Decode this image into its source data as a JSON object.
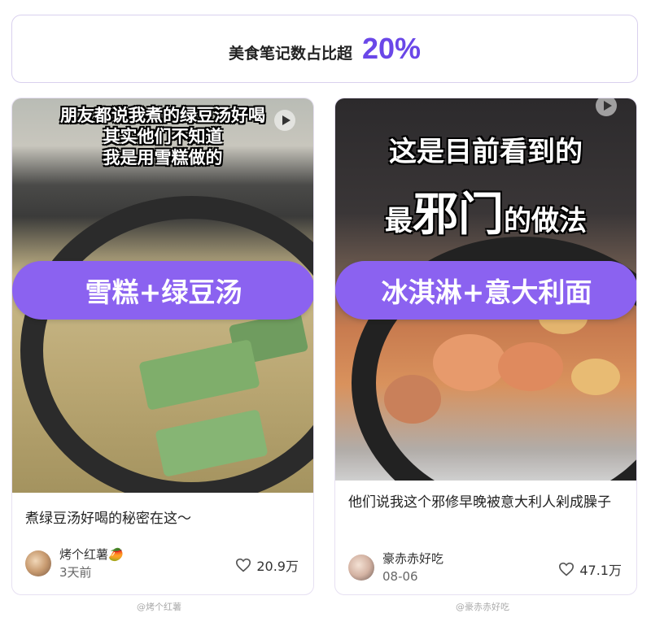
{
  "header": {
    "label": "美食笔记数占比超",
    "percent": "20%"
  },
  "cards": [
    {
      "overlay_lines": [
        "朋友都说我煮的绿豆汤好喝",
        "其实他们不知道",
        "我是用雪糕做的"
      ],
      "pill": "雪糕+绿豆汤",
      "title": "煮绿豆汤好喝的秘密在这～",
      "author": "烤个红薯🥭",
      "time": "3天前",
      "likes": "20.9万",
      "source": "@烤个红薯"
    },
    {
      "overlay_line1": "这是目前看到的",
      "overlay_line2_pre": "最",
      "overlay_line2_big": "邪门",
      "overlay_line2_post": "的做法",
      "pill": "冰淇淋+意大利面",
      "title": "他们说我这个邪修早晚被意大利人剁成臊子",
      "author": "豪赤赤好吃",
      "time": "08-06",
      "likes": "47.1万",
      "source": "@豪赤赤好吃"
    }
  ],
  "colors": {
    "accent": "#6a47e8",
    "pill": "#8b62f0"
  },
  "icons": [
    "play-icon",
    "heart-icon",
    "avatar"
  ]
}
